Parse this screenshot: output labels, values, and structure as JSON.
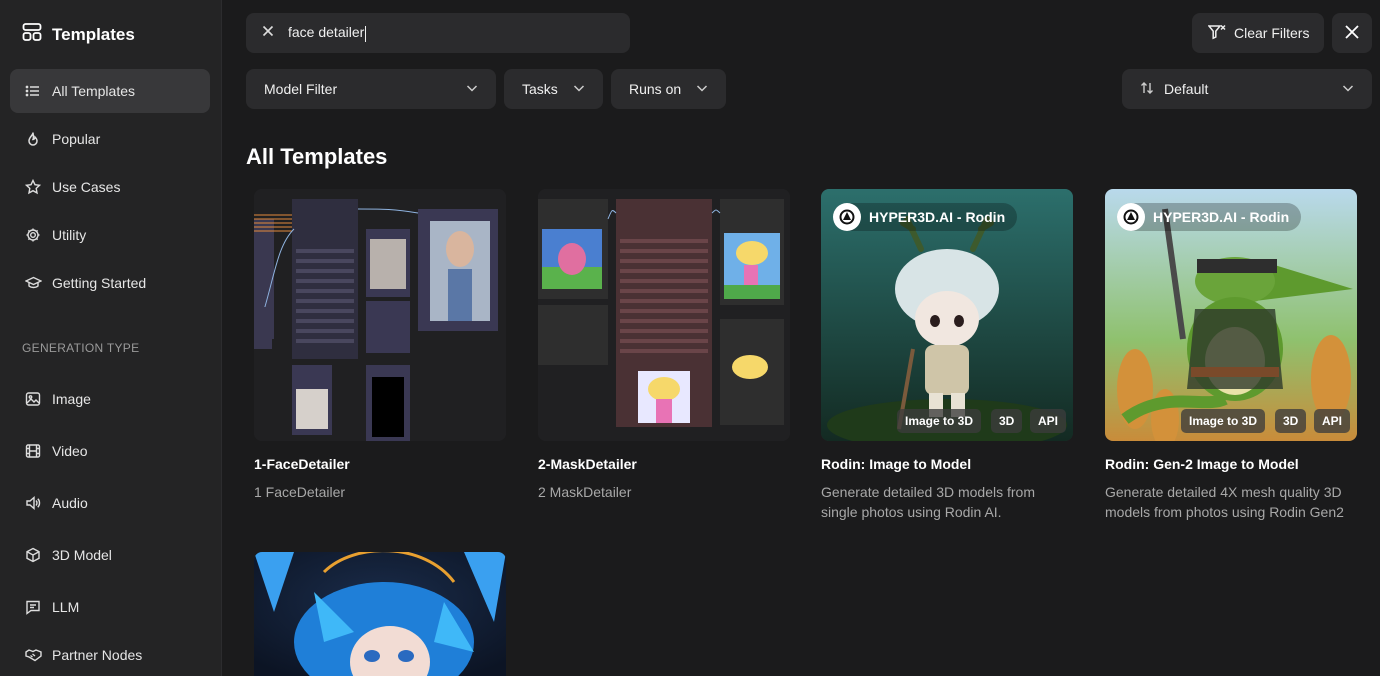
{
  "brand": {
    "title": "Templates",
    "icon": "templates-icon"
  },
  "sidebar": {
    "items": [
      {
        "label": "All Templates",
        "icon": "list-icon"
      },
      {
        "label": "Popular",
        "icon": "flame-icon"
      },
      {
        "label": "Use Cases",
        "icon": "star-icon"
      },
      {
        "label": "Utility",
        "icon": "gear-icon"
      },
      {
        "label": "Getting Started",
        "icon": "graduation-cap-icon"
      }
    ],
    "section_label": "GENERATION TYPE",
    "gen_items": [
      {
        "label": "Image",
        "icon": "image-icon"
      },
      {
        "label": "Video",
        "icon": "film-icon"
      },
      {
        "label": "Audio",
        "icon": "speaker-icon"
      },
      {
        "label": "3D Model",
        "icon": "cube-icon"
      },
      {
        "label": "LLM",
        "icon": "chat-icon"
      },
      {
        "label": "Partner Nodes",
        "icon": "handshake-icon"
      }
    ]
  },
  "search": {
    "value": "face detailer"
  },
  "toolbar": {
    "clear_filters": "Clear Filters",
    "model_filter": "Model Filter",
    "tasks": "Tasks",
    "runs_on": "Runs on",
    "sort": "Default"
  },
  "main": {
    "heading": "All Templates",
    "cards": [
      {
        "title": "1-FaceDetailer",
        "desc": "1 FaceDetailer",
        "tags": []
      },
      {
        "title": "2-MaskDetailer",
        "desc": "2 MaskDetailer",
        "tags": []
      },
      {
        "title": "Rodin: Image to Model",
        "desc": "Generate detailed 3D models from single photos using Rodin AI.",
        "brand": "HYPER3D.AI - Rodin",
        "tags": [
          "Image to 3D",
          "3D",
          "API"
        ]
      },
      {
        "title": "Rodin: Gen-2 Image to Model",
        "desc": "Generate detailed 4X mesh quality 3D models from photos using Rodin Gen2",
        "brand": "HYPER3D.AI - Rodin",
        "tags": [
          "Image to 3D",
          "3D",
          "API"
        ]
      }
    ]
  }
}
